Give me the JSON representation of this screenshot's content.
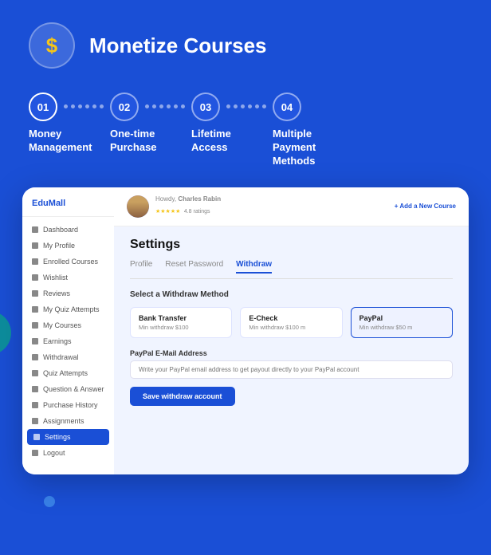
{
  "header": {
    "title": "Monetize Courses",
    "icon_symbol": "$"
  },
  "steps": [
    {
      "number": "01",
      "label": "Money Management",
      "has_dots_after": true
    },
    {
      "number": "02",
      "label": "One-time Purchase",
      "has_dots_after": true
    },
    {
      "number": "03",
      "label": "Lifetime Access",
      "has_dots_after": true
    },
    {
      "number": "04",
      "label": "Multiple Payment Methods",
      "has_dots_after": false
    }
  ],
  "sidebar": {
    "brand": "EduMall",
    "items": [
      {
        "label": "Dashboard",
        "active": false
      },
      {
        "label": "My Profile",
        "active": false
      },
      {
        "label": "Enrolled Courses",
        "active": false
      },
      {
        "label": "Wishlist",
        "active": false
      },
      {
        "label": "Reviews",
        "active": false
      },
      {
        "label": "My Quiz Attempts",
        "active": false
      },
      {
        "label": "My Courses",
        "active": false
      },
      {
        "label": "Earnings",
        "active": false
      },
      {
        "label": "Withdrawal",
        "active": false
      },
      {
        "label": "Quiz Attempts",
        "active": false
      },
      {
        "label": "Question & Answer",
        "active": false
      },
      {
        "label": "Purchase History",
        "active": false
      },
      {
        "label": "Assignments",
        "active": false
      },
      {
        "label": "Settings",
        "active": true
      },
      {
        "label": "Logout",
        "active": false
      }
    ]
  },
  "topbar": {
    "howdy": "Howdy,",
    "user_name": "Charles Rabin",
    "stars": "★★★★★",
    "rating": "4.8 ratings",
    "add_course": "+ Add a New Course"
  },
  "settings": {
    "title": "Settings",
    "tabs": [
      {
        "label": "Profile",
        "active": false
      },
      {
        "label": "Reset Password",
        "active": false
      },
      {
        "label": "Withdraw",
        "active": true
      }
    ],
    "section_label": "Select a Withdraw Method",
    "payment_methods": [
      {
        "name": "Bank Transfer",
        "min": "Min withdraw $100",
        "selected": false
      },
      {
        "name": "E-Check",
        "min": "Min withdraw $100 m",
        "selected": false
      },
      {
        "name": "PayPal",
        "min": "Min withdraw $50 m",
        "selected": true
      }
    ],
    "form_label": "PayPal E-Mail Address",
    "form_placeholder": "Write your PayPal email address to get payout directly to your PayPal account",
    "save_button": "Save withdraw account"
  }
}
